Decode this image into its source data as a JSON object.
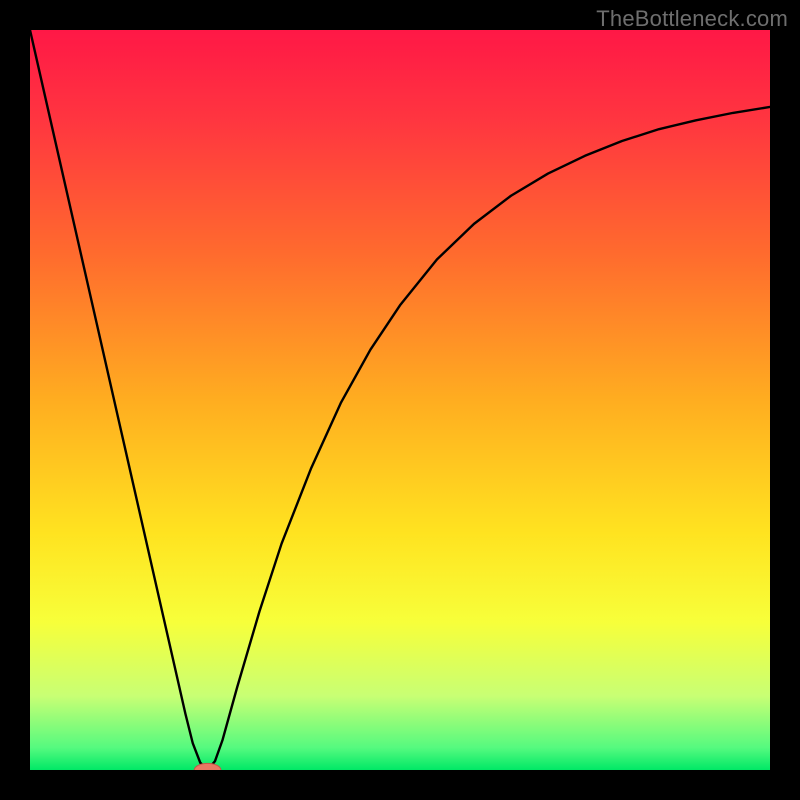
{
  "watermark": "TheBottleneck.com",
  "colors": {
    "bg": "#000000",
    "gradient_stops": [
      {
        "offset": 0,
        "color": "#ff1846"
      },
      {
        "offset": 0.12,
        "color": "#ff3540"
      },
      {
        "offset": 0.3,
        "color": "#ff6a2e"
      },
      {
        "offset": 0.5,
        "color": "#ffad20"
      },
      {
        "offset": 0.68,
        "color": "#ffe320"
      },
      {
        "offset": 0.8,
        "color": "#f7ff3a"
      },
      {
        "offset": 0.9,
        "color": "#c8ff74"
      },
      {
        "offset": 0.97,
        "color": "#55fa7f"
      },
      {
        "offset": 1.0,
        "color": "#00e866"
      }
    ],
    "curve": "#000000",
    "marker_fill": "#e97863",
    "marker_stroke": "#c65748"
  },
  "chart_data": {
    "type": "line",
    "title": "",
    "xlabel": "",
    "ylabel": "",
    "xlim": [
      0,
      100
    ],
    "ylim": [
      0,
      100
    ],
    "grid": false,
    "legend": false,
    "x": [
      0,
      3,
      6,
      9,
      12,
      15,
      18,
      21,
      22,
      23,
      24,
      25,
      26,
      28,
      31,
      34,
      38,
      42,
      46,
      50,
      55,
      60,
      65,
      70,
      75,
      80,
      85,
      90,
      95,
      100
    ],
    "values": [
      100,
      86.8,
      73.6,
      60.4,
      47.2,
      34,
      20.8,
      7.6,
      3.6,
      1.0,
      0.0,
      1.2,
      4.0,
      11.2,
      21.4,
      30.6,
      40.8,
      49.6,
      56.8,
      62.8,
      69.0,
      73.8,
      77.6,
      80.6,
      83.0,
      85.0,
      86.6,
      87.8,
      88.8,
      89.6
    ],
    "marker": {
      "x": 24,
      "y": 0,
      "rx": 1.8,
      "ry": 0.9
    },
    "annotations": []
  }
}
